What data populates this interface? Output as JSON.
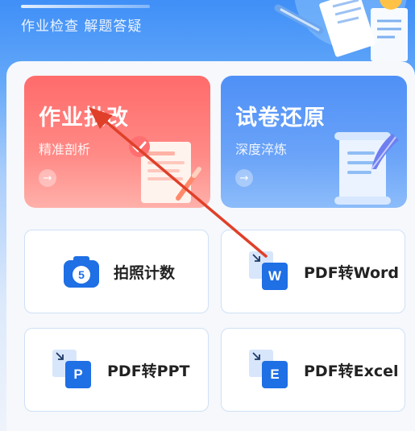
{
  "header": {
    "subtitle": "作业检查 解题答疑"
  },
  "cards": {
    "homework": {
      "title": "作业批改",
      "subtitle": "精准剖析",
      "arrow": "→"
    },
    "paper": {
      "title": "试卷还原",
      "subtitle": "深度淬炼",
      "arrow": "→"
    }
  },
  "tools": [
    {
      "label": "拍照计数",
      "icon_text": "5"
    },
    {
      "label": "PDF转Word",
      "icon_text": "W"
    },
    {
      "label": "PDF转PPT",
      "icon_text": "P"
    },
    {
      "label": "PDF转Excel",
      "icon_text": "E"
    }
  ],
  "colors": {
    "red_card": "#ff6b6b",
    "blue_card": "#4f90f7",
    "icon_blue": "#1f6fe5",
    "annotation_arrow": "#e0402a"
  }
}
